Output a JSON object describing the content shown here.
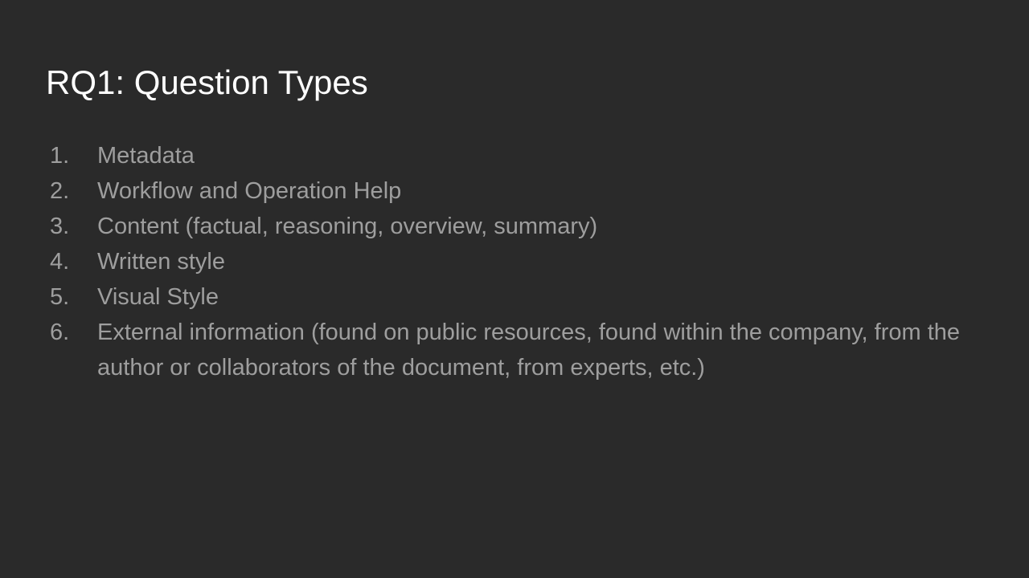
{
  "slide": {
    "title": "RQ1: Question Types",
    "items": [
      {
        "number": "1.",
        "text": "Metadata"
      },
      {
        "number": "2.",
        "text": "Workflow and Operation Help"
      },
      {
        "number": "3.",
        "text": "Content (factual, reasoning, overview, summary)"
      },
      {
        "number": "4.",
        "text": "Written style"
      },
      {
        "number": "5.",
        "text": "Visual Style"
      },
      {
        "number": "6.",
        "text": "External information (found on public resources, found within the company, from the author or collaborators of the document, from experts, etc.)"
      }
    ]
  },
  "colors": {
    "background": "#2a2a2a",
    "title": "#ffffff",
    "body_text": "#9e9e9e"
  }
}
